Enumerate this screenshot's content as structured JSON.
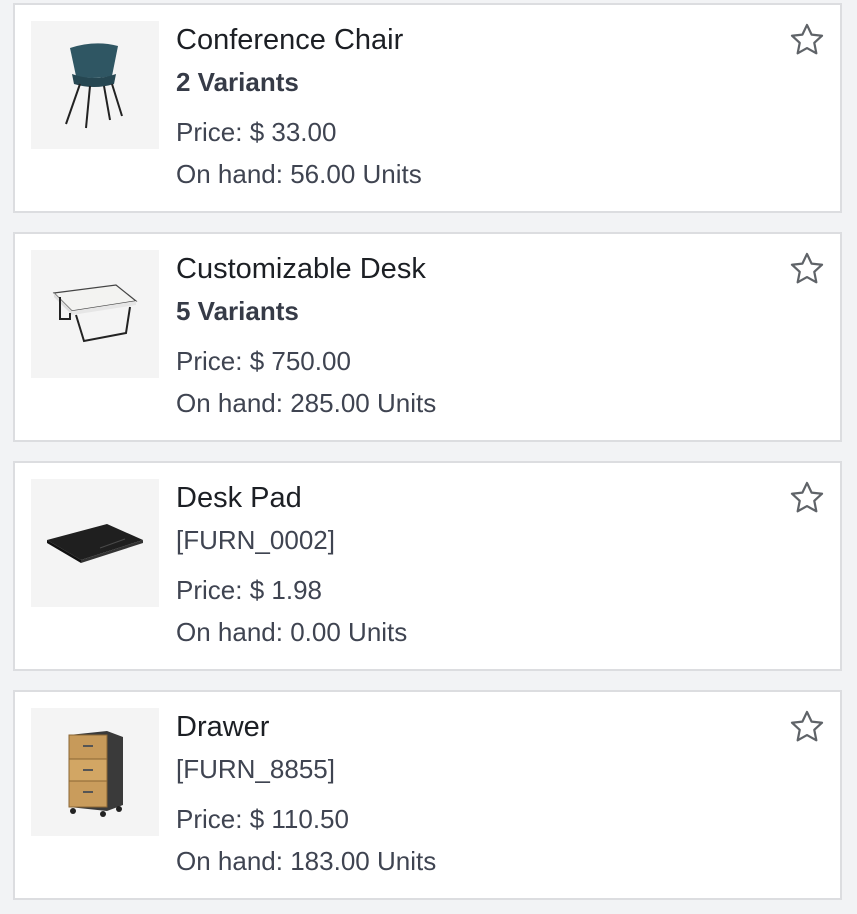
{
  "products": [
    {
      "name": "Conference Chair",
      "subtitle": "2 Variants",
      "subtitle_type": "variants",
      "price_label": "Price:",
      "price": "$ 33.00",
      "onhand_label": "On hand:",
      "onhand": "56.00 Units",
      "image_icon": "chair-icon",
      "favorite": false
    },
    {
      "name": "Customizable Desk",
      "subtitle": "5 Variants",
      "subtitle_type": "variants",
      "price_label": "Price:",
      "price": "$ 750.00",
      "onhand_label": "On hand:",
      "onhand": "285.00 Units",
      "image_icon": "desk-icon",
      "favorite": false
    },
    {
      "name": "Desk Pad",
      "subtitle": "[FURN_0002]",
      "subtitle_type": "reference",
      "price_label": "Price:",
      "price": "$ 1.98",
      "onhand_label": "On hand:",
      "onhand": "0.00 Units",
      "image_icon": "desk-pad-icon",
      "favorite": false
    },
    {
      "name": "Drawer",
      "subtitle": "[FURN_8855]",
      "subtitle_type": "reference",
      "price_label": "Price:",
      "price": "$ 110.50",
      "onhand_label": "On hand:",
      "onhand": "183.00 Units",
      "image_icon": "drawer-icon",
      "favorite": false
    }
  ],
  "colors": {
    "background": "#f2f3f5",
    "card": "#ffffff",
    "border": "#dcdde0",
    "title_text": "#1c1f24",
    "body_text": "#3f4451",
    "star_outline": "#5f6368"
  }
}
